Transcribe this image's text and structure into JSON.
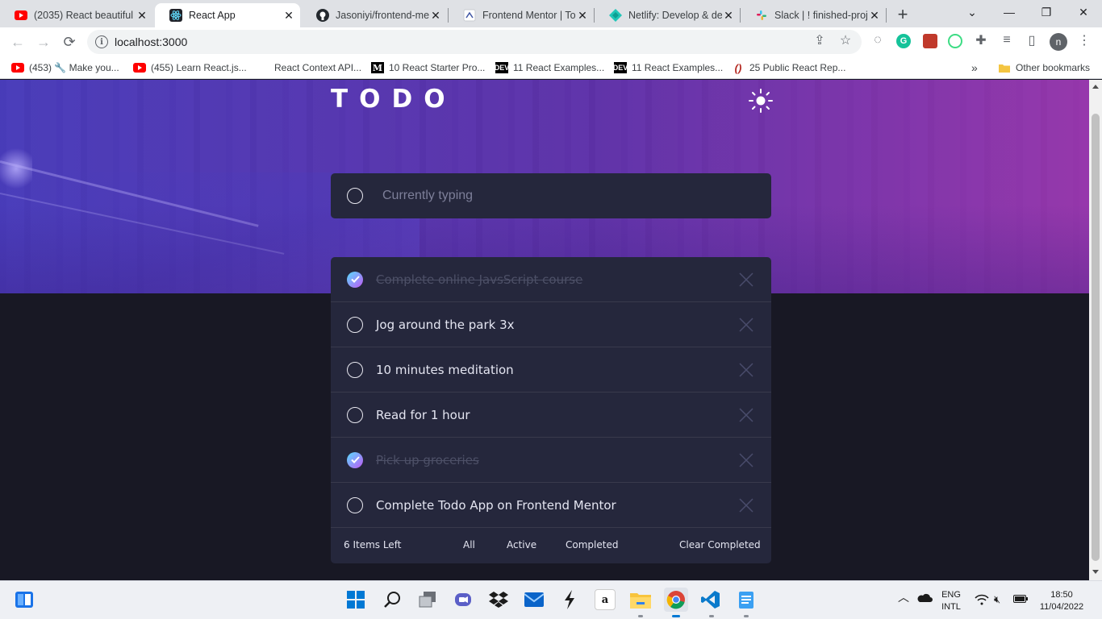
{
  "browser": {
    "tabs": [
      {
        "title": "(2035) React beautiful",
        "icon": "youtube-icon"
      },
      {
        "title": "React App",
        "icon": "react-icon",
        "active": true
      },
      {
        "title": "Jasoniyi/frontend-men",
        "icon": "github-icon"
      },
      {
        "title": "Frontend Mentor | Too",
        "icon": "frontend-mentor-icon"
      },
      {
        "title": "Netlify: Develop & dep",
        "icon": "netlify-icon"
      },
      {
        "title": "Slack | ! finished-proje",
        "icon": "slack-icon"
      }
    ],
    "url": "localhost:3000",
    "bookmarks": [
      {
        "label": "(453) 🔧 Make you...",
        "icon": "youtube-icon"
      },
      {
        "label": "(455) Learn React.js...",
        "icon": "youtube-icon"
      },
      {
        "label": "React Context API...",
        "icon": "blank-icon"
      },
      {
        "label": "10 React Starter Pro...",
        "icon": "medium-icon"
      },
      {
        "label": "11 React Examples...",
        "icon": "dev-icon"
      },
      {
        "label": "11 React Examples...",
        "icon": "dev-icon"
      },
      {
        "label": "25 Public React Rep...",
        "icon": "gitconnected-icon"
      }
    ],
    "more_bookmarks": "»",
    "other_bookmarks": "Other bookmarks",
    "profile_initial": "n",
    "extension_g": "G"
  },
  "app": {
    "title": "TODO",
    "input_placeholder": "Currently typing",
    "todos": [
      {
        "text": "Complete online JavsScript course",
        "completed": true
      },
      {
        "text": "Jog around the park 3x",
        "completed": false
      },
      {
        "text": "10 minutes meditation",
        "completed": false
      },
      {
        "text": "Read for 1 hour",
        "completed": false
      },
      {
        "text": "Pick up groceries",
        "completed": true
      },
      {
        "text": "Complete Todo App on Frontend Mentor",
        "completed": false
      }
    ],
    "items_left": "6 Items Left",
    "filters": [
      "All",
      "Active",
      "Completed"
    ],
    "clear_completed": "Clear Completed"
  },
  "taskbar": {
    "lang": "ENG",
    "layout": "INTL",
    "time": "18:50",
    "date": "11/04/2022"
  },
  "colors": {
    "accent_gradient_start": "#57ddff",
    "accent_gradient_end": "#c058f3",
    "card": "#25273c",
    "background": "#181824"
  }
}
